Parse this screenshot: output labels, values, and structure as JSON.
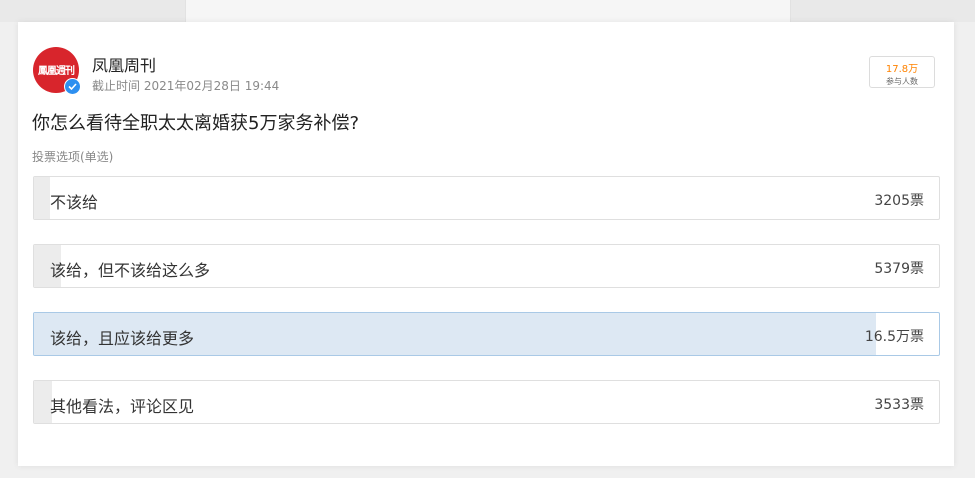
{
  "account": {
    "name": "凤凰周刊",
    "avatar_text": "鳳凰週刊",
    "deadline": "截止时间 2021年02月28日 19:44"
  },
  "participants": {
    "count": "17.8万",
    "label": "参与人数"
  },
  "poll": {
    "question": "你怎么看待全职太太离婚获5万家务补偿?",
    "vote_type": "投票选项(单选)",
    "options": [
      {
        "label": "不该给",
        "count": "3205票",
        "share": 0.018,
        "selected": false
      },
      {
        "label": "该给，但不该给这么多",
        "count": "5379票",
        "share": 0.03,
        "selected": false
      },
      {
        "label": "该给，且应该给更多",
        "count": "16.5万票",
        "share": 0.93,
        "selected": true
      },
      {
        "label": "其他看法，评论区见",
        "count": "3533票",
        "share": 0.02,
        "selected": false
      }
    ]
  },
  "colors": {
    "brand_red": "#d8252c",
    "accent_orange": "#ff8200",
    "verified_blue": "#2d8ff0",
    "selected_fill": "#dde8f3"
  }
}
